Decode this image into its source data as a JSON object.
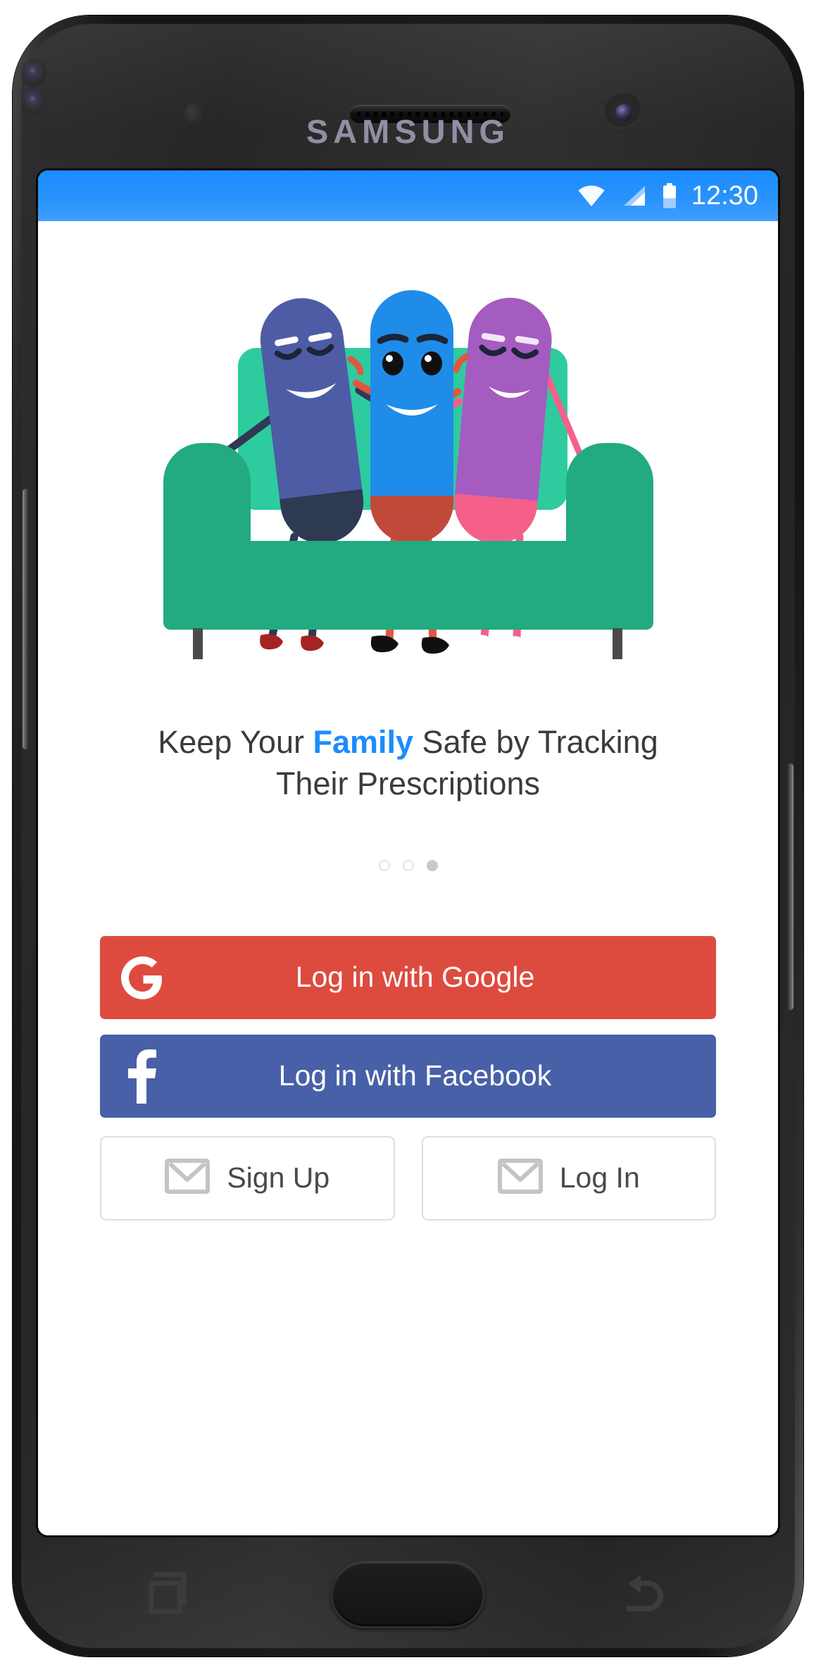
{
  "device": {
    "brand_label": "SAMSUNG",
    "hardware": {
      "proximity_sensor": "proximity-sensor",
      "light_sensor_a": "light-sensor",
      "light_sensor_b": "iris-sensor",
      "earpiece": "earpiece-speaker",
      "front_camera": "front-camera",
      "volume_button": "volume-button",
      "power_button": "power-button"
    }
  },
  "status_bar": {
    "time": "12:30",
    "icons": [
      "wifi-icon",
      "cellular-signal-icon",
      "battery-icon"
    ],
    "background_color": "#2b93fb"
  },
  "illustration": {
    "name": "three-pill-characters-on-couch",
    "couch_back_color": "#2ecb9e",
    "couch_body_color": "#22ab80",
    "couch_leg_color": "#4a4a4a",
    "characters": [
      {
        "name": "character-indigo-pill",
        "body_color": "#4e5ca5",
        "pants_color": "#2e3a52",
        "shoe_color": "#a62323",
        "limb_color": "#2e3a52"
      },
      {
        "name": "character-blue-pill",
        "body_color": "#1e8ce8",
        "pants_color": "#c0493a",
        "shoe_color": "#101010",
        "limb_color": "#e2553f"
      },
      {
        "name": "character-purple-pill",
        "body_color": "#a45cc0",
        "pants_color": "#f4608a",
        "shoe_color": "#ffffff",
        "limb_color": "#f4608a"
      }
    ]
  },
  "headline": {
    "part1": "Keep Your ",
    "accent": "Family",
    "part2": " Safe by Tracking Their Prescriptions",
    "accent_color": "#1a8cff",
    "text_color": "#3b3b3b"
  },
  "pagination": {
    "total": 3,
    "active_index": 2,
    "dots": [
      "page-dot-1",
      "page-dot-2",
      "page-dot-3"
    ]
  },
  "auth": {
    "google": {
      "label": "Log in with Google",
      "icon": "google-g-icon",
      "background_color": "#dd4b3e",
      "text_color": "#ffffff"
    },
    "facebook": {
      "label": "Log in with Facebook",
      "icon": "facebook-f-icon",
      "background_color": "#4860a8",
      "text_color": "#ffffff"
    },
    "sign_up": {
      "label": "Sign Up",
      "icon": "envelope-icon",
      "border_color": "#dedede",
      "text_color": "#4a4a4a"
    },
    "log_in": {
      "label": "Log In",
      "icon": "envelope-icon",
      "border_color": "#dedede",
      "text_color": "#4a4a4a"
    }
  },
  "nav_bar": {
    "recents": "recents-icon",
    "home": "home-button",
    "back": "back-icon"
  }
}
